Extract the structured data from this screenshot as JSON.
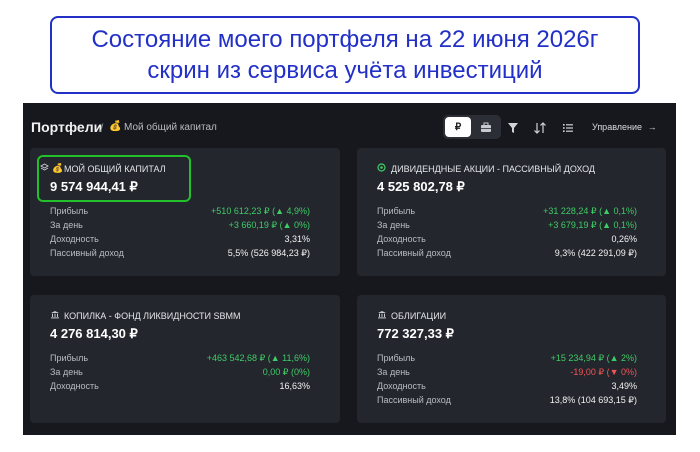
{
  "banner": {
    "line1": "Состояние моего портфеля на 22 июня 2026г",
    "line2": "скрин из сервиса учёта инвестиций"
  },
  "header": {
    "title": "Портфели",
    "separator": "/",
    "breadcrumb": "Мой общий капитал",
    "currency_button": "₽",
    "manage_label": "Управление"
  },
  "cards": [
    {
      "title": "МОЙ ОБЩИЙ КАПИТАЛ",
      "value": "9 574 944,41 ₽",
      "rows": [
        {
          "label": "Прибыль",
          "value": "+510 612,23 ₽ (▲ 4,9%)"
        },
        {
          "label": "За день",
          "value": "+3 660,19 ₽ (▲ 0%)"
        },
        {
          "label": "Доходность",
          "value": "3,31%"
        },
        {
          "label": "Пассивный доход",
          "value": "5,5% (526 984,23 ₽)"
        }
      ]
    },
    {
      "title": "ДИВИДЕНДНЫЕ АКЦИИ - ПАССИВНЫЙ ДОХОД",
      "value": "4 525 802,78 ₽",
      "rows": [
        {
          "label": "Прибыль",
          "value": "+31 228,24 ₽ (▲ 0,1%)"
        },
        {
          "label": "За день",
          "value": "+3 679,19 ₽ (▲ 0,1%)"
        },
        {
          "label": "Доходность",
          "value": "0,26%"
        },
        {
          "label": "Пассивный доход",
          "value": "9,3% (422 291,09 ₽)"
        }
      ]
    },
    {
      "title": "КОПИЛКА - ФОНД ЛИКВИДНОСТИ SBMM",
      "value": "4 276 814,30 ₽",
      "rows": [
        {
          "label": "Прибыль",
          "value": "+463 542,68 ₽ (▲ 11,6%)"
        },
        {
          "label": "За день",
          "value": "0,00 ₽ (0%)"
        },
        {
          "label": "Доходность",
          "value": "16,63%"
        }
      ]
    },
    {
      "title": "ОБЛИГАЦИИ",
      "value": "772 327,33 ₽",
      "rows": [
        {
          "label": "Прибыль",
          "value": "+15 234,94 ₽ (▲ 2%)"
        },
        {
          "label": "За день",
          "value": "-19,00 ₽ (▼ 0%)"
        },
        {
          "label": "Доходность",
          "value": "3,49%"
        },
        {
          "label": "Пассивный доход",
          "value": "13,8% (104 693,15 ₽)"
        }
      ]
    }
  ],
  "colors": {
    "banner_blue": "#2230c8",
    "background": "#16181d",
    "card": "#23262d",
    "positive": "#3fcc66",
    "negative": "#f05454",
    "highlight": "#22c02a"
  },
  "icons": [
    "money-bag-icon",
    "layers-icon",
    "dividend-icon",
    "bank-icon",
    "briefcase-icon",
    "filter-icon",
    "sort-icon",
    "list-icon",
    "arrow-right-icon"
  ]
}
